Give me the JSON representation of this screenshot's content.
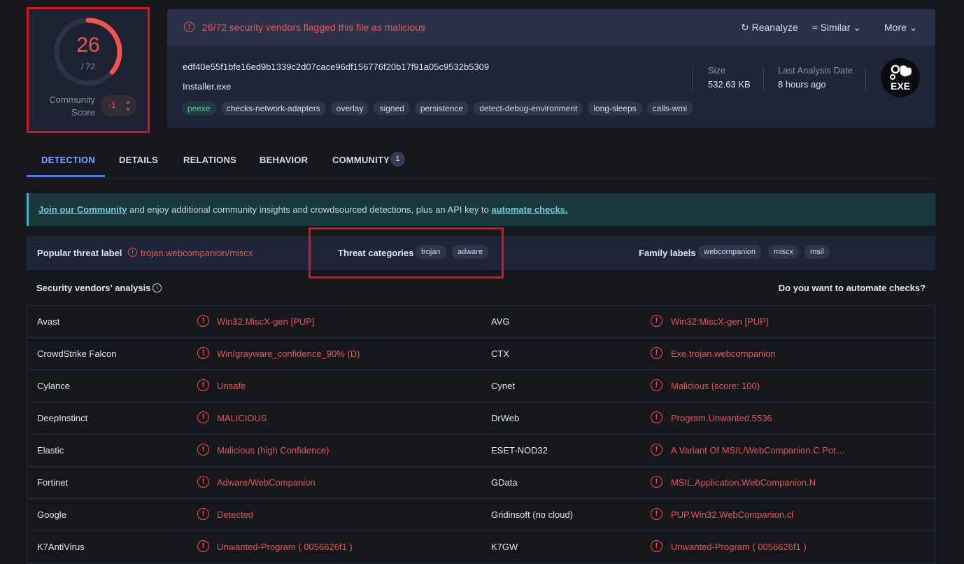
{
  "score": {
    "detected": "26",
    "total": "/ 72",
    "community_label": "Community Score",
    "community_value": "-1"
  },
  "alert": {
    "text": "26/72 security vendors flagged this file as malicious"
  },
  "actions": {
    "reanalyze": "Reanalyze",
    "similar": "Similar",
    "more": "More"
  },
  "file": {
    "hash": "edf40e55f1bfe16ed9b1339c2d07cace96df156776f20b17f91a05c9532b5309",
    "name": "Installer.exe",
    "tags": [
      "peexe",
      "checks-network-adapters",
      "overlay",
      "signed",
      "persistence",
      "detect-debug-environment",
      "long-sleeps",
      "calls-wmi"
    ],
    "size_label": "Size",
    "size_value": "532.63 KB",
    "date_label": "Last Analysis Date",
    "date_value": "8 hours ago",
    "type_badge": "EXE"
  },
  "tabs": {
    "detection": "DETECTION",
    "details": "DETAILS",
    "relations": "RELATIONS",
    "behavior": "BEHAVIOR",
    "community": "COMMUNITY",
    "community_count": "1"
  },
  "banner": {
    "link1": "Join our Community",
    "middle": " and enjoy additional community insights and crowdsourced detections, plus an API key to ",
    "link2": "automate checks."
  },
  "threat": {
    "popular_label": "Popular threat label",
    "popular_value": "trojan.webcompanion/miscx",
    "categories_label": "Threat categories",
    "categories": [
      "trojan",
      "adware"
    ],
    "family_label": "Family labels",
    "families": [
      "webcompanion",
      "miscx",
      "msil"
    ]
  },
  "vendors_title": "Security vendors' analysis",
  "automate_question": "Do you want to automate checks?",
  "vendors": [
    {
      "left_name": "Avast",
      "left_result": "Win32:MiscX-gen [PUP]",
      "right_name": "AVG",
      "right_result": "Win32:MiscX-gen [PUP]"
    },
    {
      "left_name": "CrowdStrike Falcon",
      "left_result": "Win/grayware_confidence_90% (D)",
      "right_name": "CTX",
      "right_result": "Exe.trojan.webcompanion"
    },
    {
      "left_name": "Cylance",
      "left_result": "Unsafe",
      "right_name": "Cynet",
      "right_result": "Malicious (score: 100)"
    },
    {
      "left_name": "DeepInstinct",
      "left_result": "MALICIOUS",
      "right_name": "DrWeb",
      "right_result": "Program.Unwanted.5536"
    },
    {
      "left_name": "Elastic",
      "left_result": "Malicious (high Confidence)",
      "right_name": "ESET-NOD32",
      "right_result": "A Variant Of MSIL/WebCompanion.C Pot…"
    },
    {
      "left_name": "Fortinet",
      "left_result": "Adware/WebCompanion",
      "right_name": "GData",
      "right_result": "MSIL.Application.WebCompanion.N"
    },
    {
      "left_name": "Google",
      "left_result": "Detected",
      "right_name": "Gridinsoft (no cloud)",
      "right_result": "PUP.Win32.WebCompanion.cl"
    },
    {
      "left_name": "K7AntiVirus",
      "left_result": "Unwanted-Program ( 0056626f1 )",
      "right_name": "K7GW",
      "right_result": "Unwanted-Program ( 0056626f1 )"
    }
  ],
  "colors": {
    "malicious": "#f0544f",
    "accent": "#4e7fe6",
    "highlight_box": "#d8171d"
  }
}
